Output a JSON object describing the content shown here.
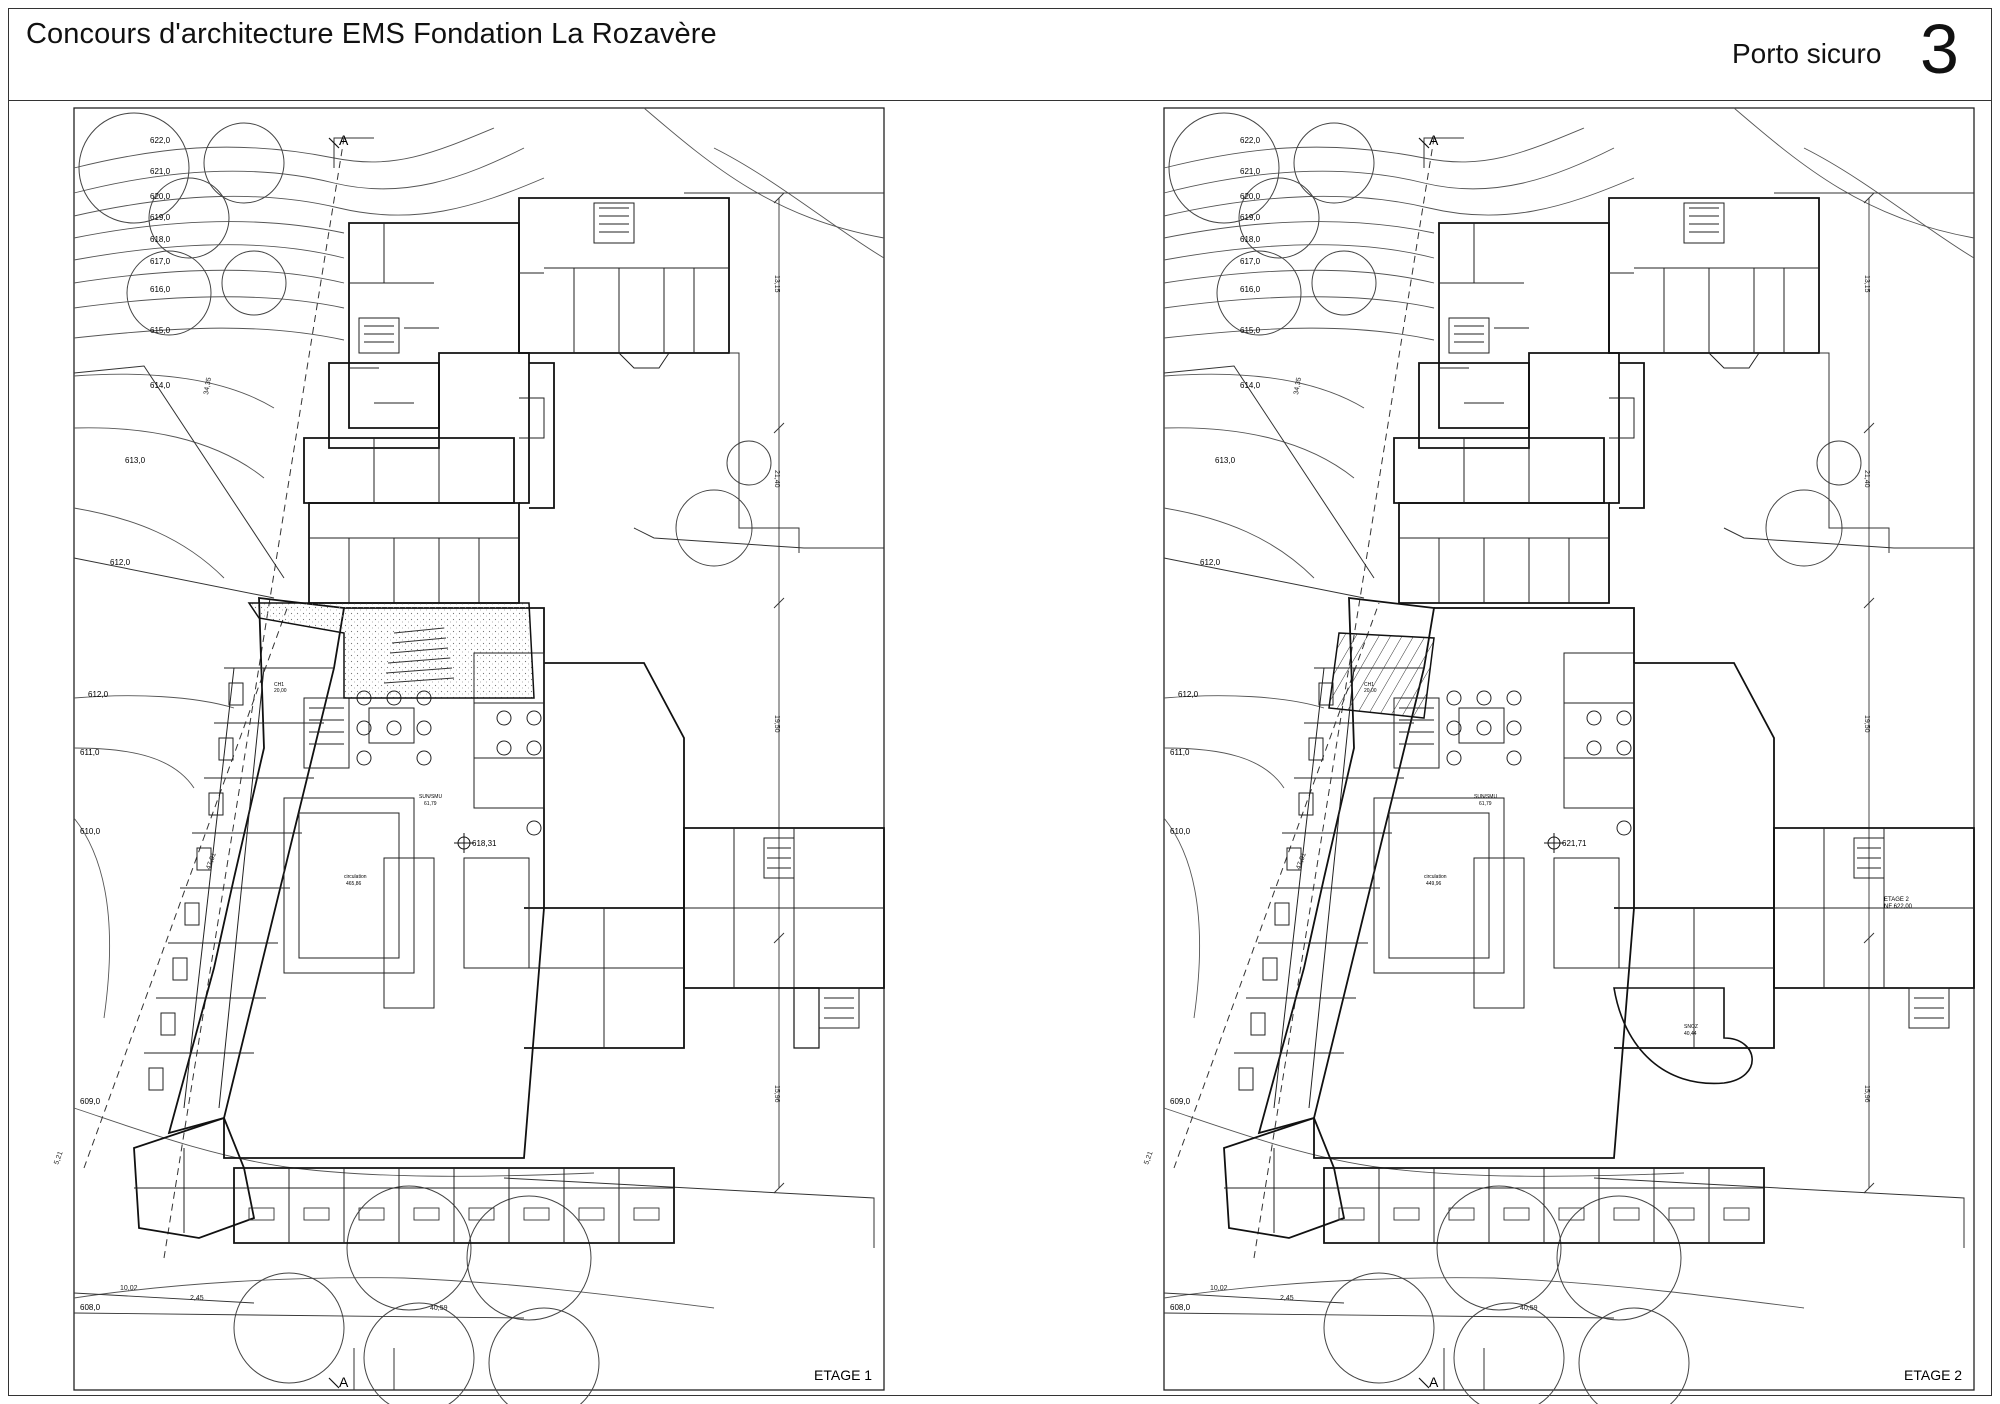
{
  "header": {
    "title": "Concours d'architecture EMS Fondation La Rozavère",
    "project": "Porto sicuro",
    "board_number": "3"
  },
  "plans": [
    {
      "level_label": "ETAGE 1",
      "section_mark": "A",
      "spot_level": "618,31",
      "circulation": "circulation",
      "circulation_area": "465,86",
      "sunsmu": "SUN/SMU",
      "sunsmu_area": "61,79",
      "ch_label": "CH1",
      "ch_area": "20,00"
    },
    {
      "level_label": "ETAGE 2",
      "section_mark": "A",
      "spot_level": "621,71",
      "circulation": "circulation",
      "circulation_area": "449,96",
      "sunsmu": "SUN/SMU",
      "sunsmu_area": "61,79",
      "ch_label": "CH1",
      "ch_area": "20,00",
      "etage_note": "ETAGE 2",
      "etage_note_level": "NF 622,00",
      "snoz": "SNOZ",
      "snoz_area": "40,44"
    }
  ],
  "contour_labels": [
    "622,0",
    "621,0",
    "620,0",
    "619,0",
    "618,0",
    "617,0",
    "616,0",
    "615,0",
    "614,0",
    "613,0",
    "612,0",
    "612,0",
    "611,0",
    "610,0",
    "609,0",
    "608,0"
  ],
  "dimensions": {
    "d1": "13,15",
    "d2": "21,40",
    "d3": "19,50",
    "d4": "15,96",
    "d5": "47,01",
    "d6": "10,02",
    "d7": "2,45",
    "d8": "40,59",
    "d9": "5,21",
    "d10": "34,35"
  },
  "colors": {
    "line": "#1a1a1a",
    "hatch": "#bdbdbd",
    "frame": "#333333"
  }
}
